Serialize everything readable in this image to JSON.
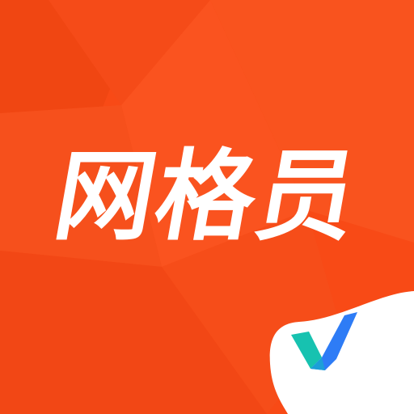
{
  "app_icon": {
    "title": "网格员",
    "icon": "checkmark-icon",
    "colors": {
      "background": "#F84A16",
      "facet_dark": "#E8420F",
      "facet_light": "#FA5A22",
      "corner_panel": "#FFFFFF",
      "check_teal": "#17C2B0",
      "check_blue": "#2E7CF6"
    }
  }
}
